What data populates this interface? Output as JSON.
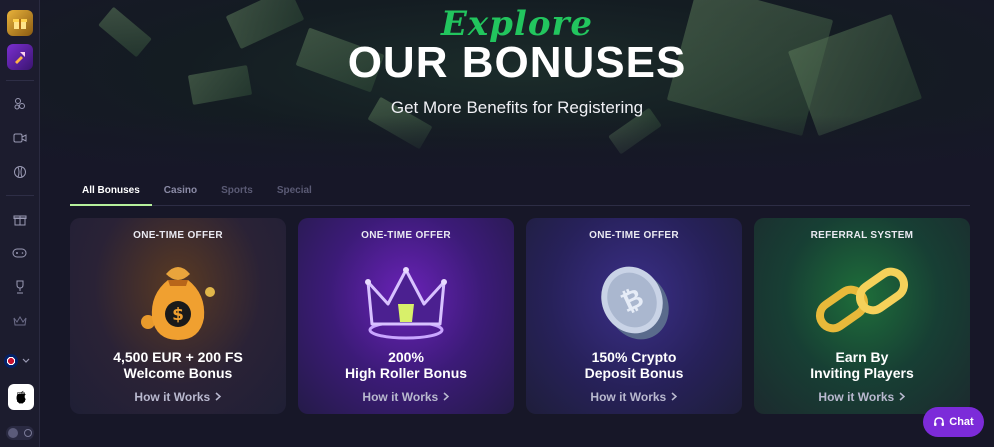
{
  "hero": {
    "script_word": "Explore",
    "title": "OUR BONUSES",
    "subtitle": "Get More Benefits for Registering"
  },
  "tabs": [
    {
      "label": "All Bonuses",
      "active": true
    },
    {
      "label": "Casino",
      "active": false
    },
    {
      "label": "Sports",
      "active": false
    },
    {
      "label": "Special",
      "active": false
    }
  ],
  "cards": [
    {
      "tag": "ONE-TIME OFFER",
      "title_line1": "4,500 EUR + 200 FS",
      "title_line2": "Welcome Bonus",
      "link": "How it Works",
      "art": "money-bag-icon"
    },
    {
      "tag": "ONE-TIME OFFER",
      "title_line1": "200%",
      "title_line2": "High Roller Bonus",
      "link": "How it Works",
      "art": "crown-icon"
    },
    {
      "tag": "ONE-TIME OFFER",
      "title_line1": "150% Crypto",
      "title_line2": "Deposit Bonus",
      "link": "How it Works",
      "art": "crypto-coin-icon"
    },
    {
      "tag": "REFERRAL SYSTEM",
      "title_line1": "Earn By",
      "title_line2": "Inviting Players",
      "link": "How it Works",
      "art": "chain-link-icon"
    }
  ],
  "chat": {
    "label": "Chat"
  },
  "colors": {
    "accent_green": "#22c55e",
    "tab_underline": "#b6f09c",
    "chat_purple": "#7c2bd9",
    "background": "#171728"
  }
}
